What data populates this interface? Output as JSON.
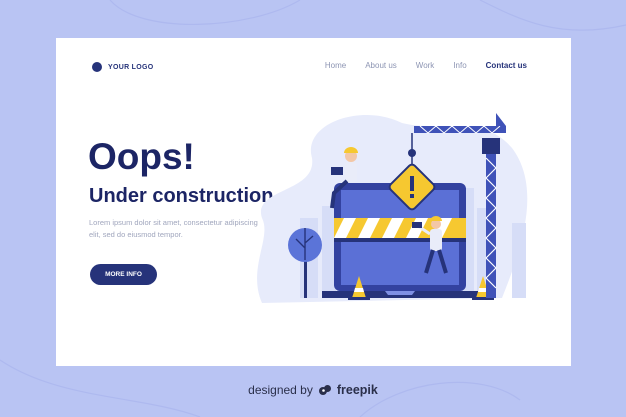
{
  "logo": {
    "text": "YOUR LOGO"
  },
  "nav": [
    {
      "label": "Home"
    },
    {
      "label": "About us"
    },
    {
      "label": "Work"
    },
    {
      "label": "Info"
    },
    {
      "label": "Contact us"
    }
  ],
  "hero": {
    "title": "Oops!",
    "subtitle": "Under construction",
    "body": "Lorem ipsum dolor sit amet, consectetur adipiscing elit, sed do eiusmod tempor.",
    "cta_label": "MORE INFO"
  },
  "footer": {
    "prefix": "designed by",
    "brand": "freepik"
  },
  "colors": {
    "background": "#b9c4f3",
    "primary": "#26337a",
    "accent": "#f6c830",
    "text_muted": "#a0a6bd"
  },
  "icons": [
    "warning-sign-icon",
    "laptop-icon",
    "crane-icon",
    "traffic-cone-icon",
    "tree-icon",
    "freepik-logo-icon"
  ]
}
